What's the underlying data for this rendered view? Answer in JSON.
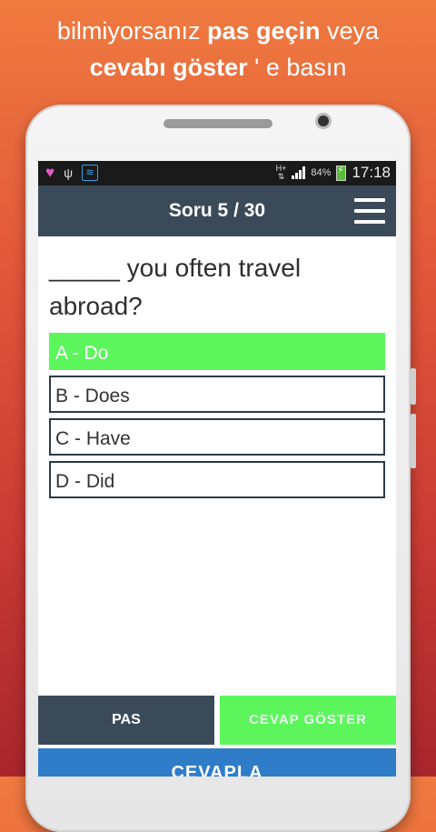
{
  "promo": {
    "line1_pre": "bilmiyorsanız ",
    "line1_bold": "pas geçin",
    "line1_post": " veya",
    "line2_bold": "cevabı göster",
    "line2_post": " ' e basın"
  },
  "statusbar": {
    "network": "H+",
    "battery_percent": "84%",
    "time": "17:18"
  },
  "header": {
    "title": "Soru 5 / 30"
  },
  "question": {
    "text": "_____ you often travel abroad?"
  },
  "options": [
    {
      "label": "A - Do",
      "selected": true
    },
    {
      "label": "B - Does",
      "selected": false
    },
    {
      "label": "C - Have",
      "selected": false
    },
    {
      "label": "D - Did",
      "selected": false
    }
  ],
  "buttons": {
    "pass": "PAS",
    "show_answer": "CEVAP GÖSTER",
    "answer": "CEVAPLA"
  },
  "colors": {
    "header": "#3b4a59",
    "selected_option": "#5cf65c",
    "answer_button": "#2f7cc8"
  }
}
